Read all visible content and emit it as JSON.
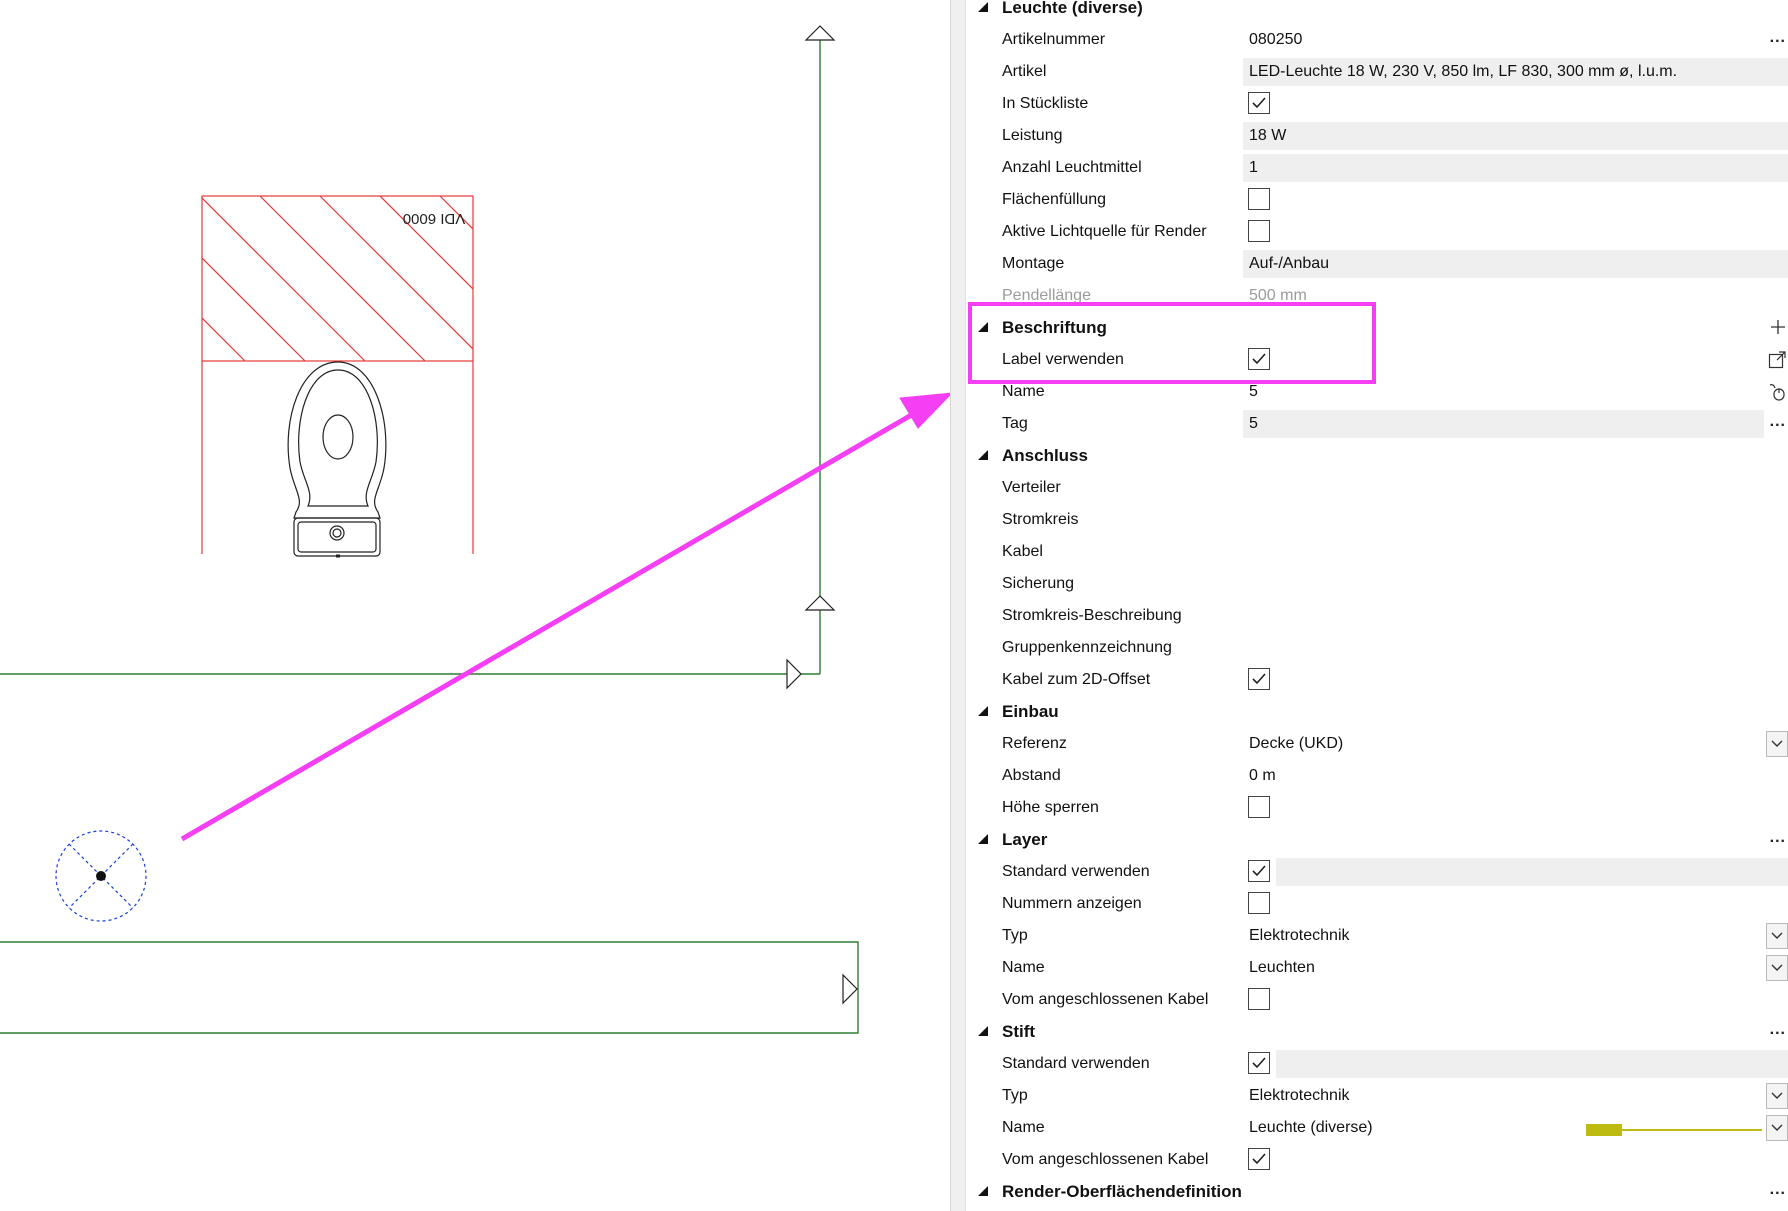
{
  "colors": {
    "highlight": "#f53ff5",
    "accent_pen": "#bdba12",
    "drawing_red": "#e53a3a",
    "drawing_green": "#2e7d32"
  },
  "canvas": {
    "stamp_text": "VDI 6000"
  },
  "panel": {
    "rows": [
      {
        "kind": "section",
        "label": "Leuchte (diverse)"
      },
      {
        "kind": "prop",
        "label": "Artikelnummer",
        "value": "080250",
        "bg": false,
        "action": "more"
      },
      {
        "kind": "prop",
        "label": "Artikel",
        "value": "LED-Leuchte 18 W, 230 V, 850 lm, LF 830, 300 mm ø, l.u.m.",
        "bg": true
      },
      {
        "kind": "check",
        "label": "In Stückliste",
        "checked": true
      },
      {
        "kind": "prop",
        "label": "Leistung",
        "value": "18 W",
        "bg": true
      },
      {
        "kind": "prop",
        "label": "Anzahl Leuchtmittel",
        "value": "1",
        "bg": true
      },
      {
        "kind": "check",
        "label": "Flächenfüllung",
        "checked": false
      },
      {
        "kind": "check",
        "label": "Aktive Lichtquelle für Render",
        "checked": false
      },
      {
        "kind": "prop",
        "label": "Montage",
        "value": "Auf-/Anbau",
        "bg": true
      },
      {
        "kind": "prop",
        "label": "Pendellänge",
        "value": "500 mm",
        "bg": false,
        "disabled": true
      },
      {
        "kind": "section",
        "label": "Beschriftung",
        "action": "plus"
      },
      {
        "kind": "check",
        "label": "Label verwenden",
        "checked": true,
        "action": "external"
      },
      {
        "kind": "prop",
        "label": "Name",
        "value": "5",
        "bg": false,
        "action": "mouse"
      },
      {
        "kind": "prop",
        "label": "Tag",
        "value": "5",
        "bg": true,
        "narrow": true,
        "action": "more"
      },
      {
        "kind": "section",
        "label": "Anschluss"
      },
      {
        "kind": "prop",
        "label": "Verteiler",
        "value": "",
        "bg": false
      },
      {
        "kind": "prop",
        "label": "Stromkreis",
        "value": "",
        "bg": false
      },
      {
        "kind": "prop",
        "label": "Kabel",
        "value": "",
        "bg": false
      },
      {
        "kind": "prop",
        "label": "Sicherung",
        "value": "",
        "bg": false
      },
      {
        "kind": "prop",
        "label": "Stromkreis-Beschreibung",
        "value": "",
        "bg": false
      },
      {
        "kind": "prop",
        "label": "Gruppenkennzeichnung",
        "value": "",
        "bg": false
      },
      {
        "kind": "check",
        "label": "Kabel zum 2D-Offset",
        "checked": true
      },
      {
        "kind": "section",
        "label": "Einbau"
      },
      {
        "kind": "prop",
        "label": "Referenz",
        "value": "Decke (UKD)",
        "bg": false,
        "action": "dropdown"
      },
      {
        "kind": "prop",
        "label": "Abstand",
        "value": "0 m",
        "bg": false
      },
      {
        "kind": "check",
        "label": "Höhe sperren",
        "checked": false
      },
      {
        "kind": "section",
        "label": "Layer",
        "action": "more"
      },
      {
        "kind": "check",
        "label": "Standard verwenden",
        "checked": true,
        "bg": true
      },
      {
        "kind": "check",
        "label": "Nummern anzeigen",
        "checked": false
      },
      {
        "kind": "prop",
        "label": "Typ",
        "value": "Elektrotechnik",
        "bg": false,
        "action": "dropdown"
      },
      {
        "kind": "prop",
        "label": "Name",
        "value": "Leuchten",
        "bg": false,
        "action": "dropdown"
      },
      {
        "kind": "check",
        "label": "Vom angeschlossenen Kabel",
        "checked": false
      },
      {
        "kind": "section",
        "label": "Stift",
        "action": "more"
      },
      {
        "kind": "check",
        "label": "Standard verwenden",
        "checked": true,
        "bg": true
      },
      {
        "kind": "prop",
        "label": "Typ",
        "value": "Elektrotechnik",
        "bg": false,
        "action": "dropdown"
      },
      {
        "kind": "prop",
        "label": "Name",
        "value": "Leuchte (diverse)",
        "bg": false,
        "action": "dropdown",
        "color_swatch": true
      },
      {
        "kind": "check",
        "label": "Vom angeschlossenen Kabel",
        "checked": true
      },
      {
        "kind": "section",
        "label": "Render-Oberflächendefinition",
        "action": "more"
      }
    ]
  }
}
